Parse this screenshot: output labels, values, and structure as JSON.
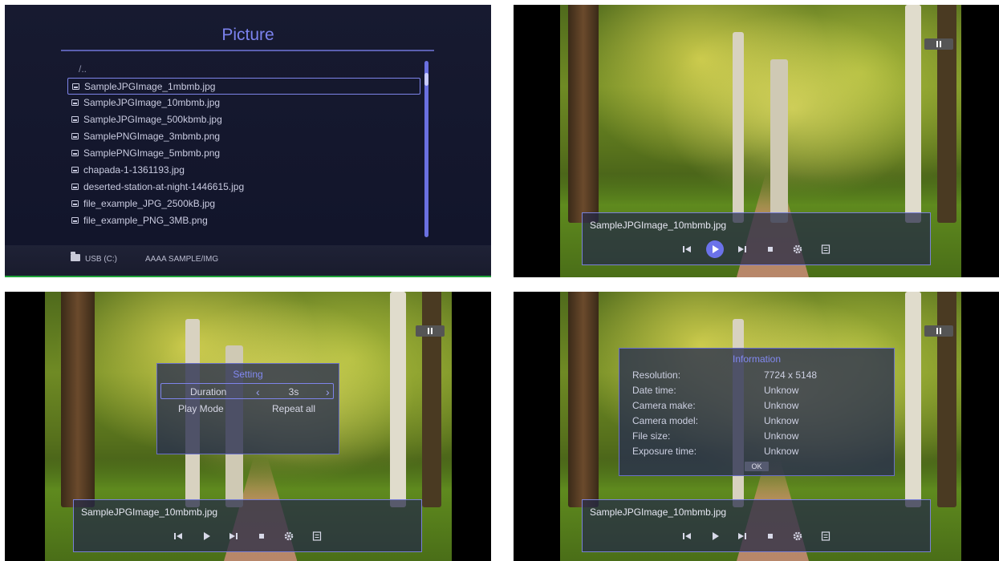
{
  "browser": {
    "title": "Picture",
    "parent_entry": "/..",
    "files": [
      "SampleJPGImage_1mbmb.jpg",
      "SampleJPGImage_10mbmb.jpg",
      "SampleJPGImage_500kbmb.jpg",
      "SamplePNGImage_3mbmb.png",
      "SamplePNGImage_5mbmb.png",
      "chapada-1-1361193.jpg",
      "deserted-station-at-night-1446615.jpg",
      "file_example_JPG_2500kB.jpg",
      "file_example_PNG_3MB.png"
    ],
    "selected_index": 0,
    "device": "USB (C:)",
    "path": "AAAA SAMPLE/IMG"
  },
  "player": {
    "filename": "SampleJPGImage_10mbmb.jpg",
    "controls": [
      "prev-track-icon",
      "play-icon",
      "next-track-icon",
      "stop-icon",
      "gear-icon",
      "list-icon"
    ]
  },
  "setting": {
    "title": "Setting",
    "duration_label": "Duration",
    "duration_value": "3s",
    "play_mode_label": "Play Mode",
    "play_mode_value": "Repeat all"
  },
  "info": {
    "title": "Information",
    "rows": [
      {
        "label": "Resolution:",
        "value": "7724 x 5148"
      },
      {
        "label": "Date time:",
        "value": "Unknow"
      },
      {
        "label": "Camera make:",
        "value": "Unknow"
      },
      {
        "label": "Camera model:",
        "value": "Unknow"
      },
      {
        "label": "File size:",
        "value": "Unknow"
      },
      {
        "label": "Exposure time:",
        "value": "Unknow"
      }
    ],
    "ok_label": "OK"
  },
  "colors": {
    "accent": "#7b82ee",
    "highlight": "#6b72ea",
    "status_green": "#1fa33a"
  }
}
